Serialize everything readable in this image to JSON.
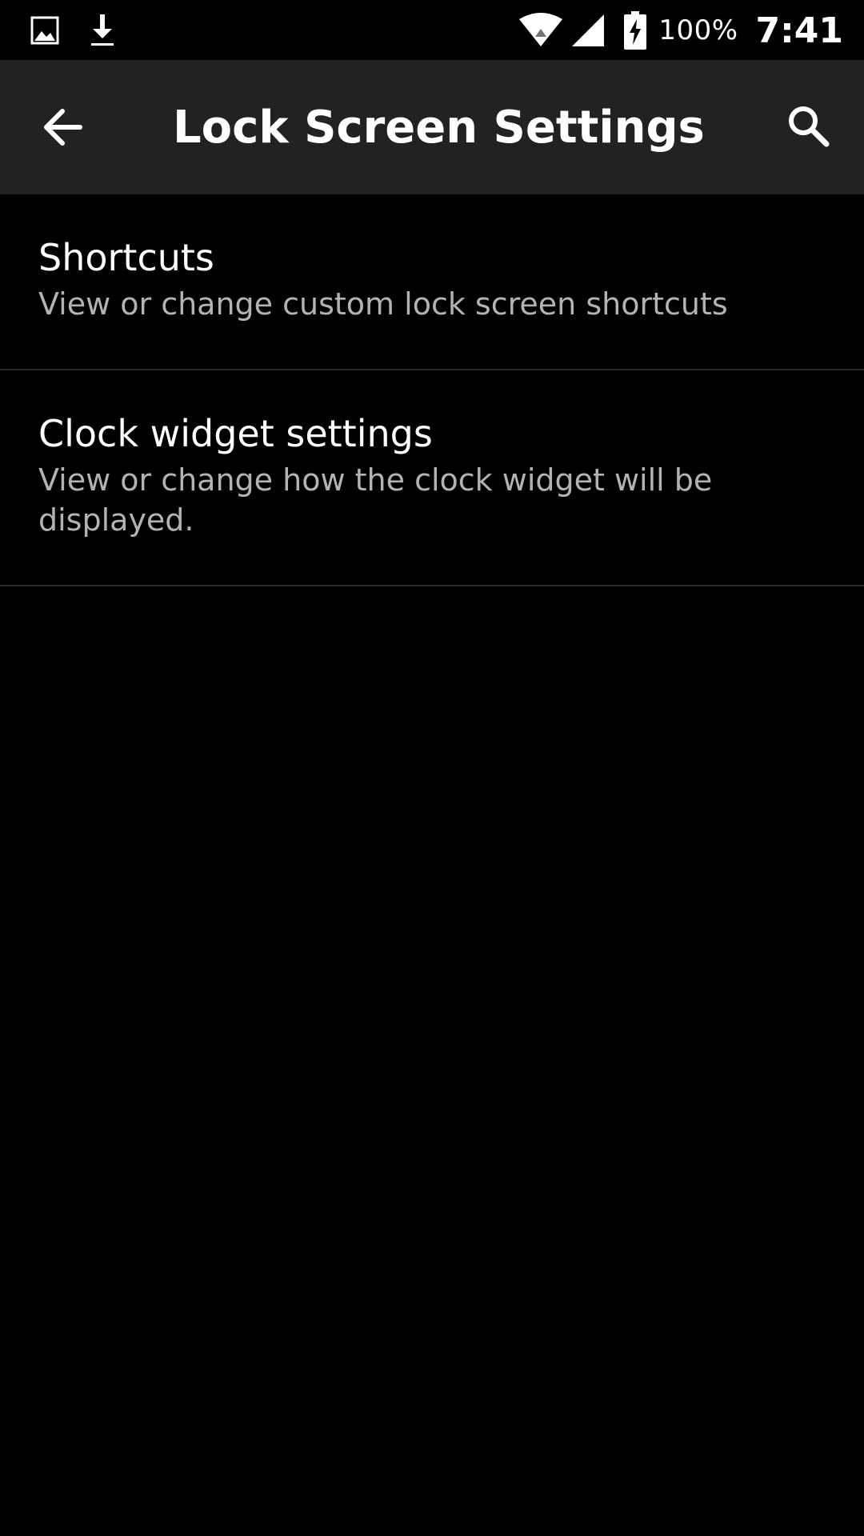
{
  "status_bar": {
    "icons_left": [
      "image-icon",
      "download-icon"
    ],
    "icons_right": [
      "wifi-icon",
      "signal-icon",
      "battery-charging-icon"
    ],
    "battery_percent": "100%",
    "time": "7:41"
  },
  "toolbar": {
    "title": "Lock Screen Settings",
    "back_icon": "arrow-back-icon",
    "search_icon": "search-icon"
  },
  "settings": {
    "items": [
      {
        "title": "Shortcuts",
        "summary": "View or change custom lock screen shortcuts"
      },
      {
        "title": "Clock widget settings",
        "summary": "View or change how the clock widget will be displayed."
      }
    ]
  },
  "colors": {
    "background": "#000000",
    "toolbar": "#222222",
    "primary_text": "#ffffff",
    "secondary_text": "#b3b3b3",
    "divider": "#2a2a2a"
  }
}
